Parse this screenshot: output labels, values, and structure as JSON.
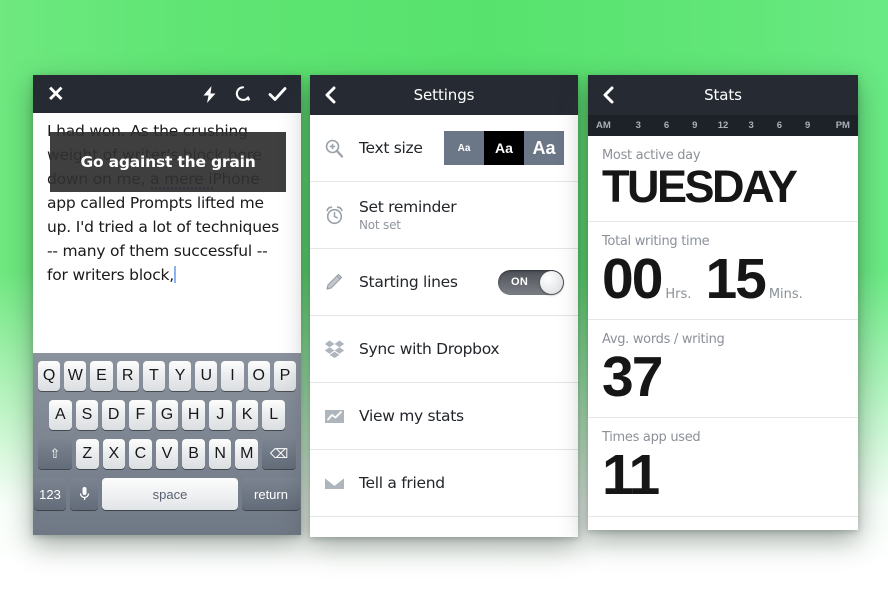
{
  "background": {
    "accent": "#5FE573"
  },
  "editor": {
    "toolbar": {
      "close_label": "✕",
      "icons": [
        "flash-icon",
        "refresh-icon",
        "check-icon"
      ]
    },
    "document_text": "I had won. As the crushing weight of writer's block bore down on me, a mere iPhone app called Prompts lifted me up. I'd tried a lot of techniques -- many of them successful -- for writers block,",
    "prompt_overlay": "Go against the grain",
    "keyboard": {
      "row1": [
        "Q",
        "W",
        "E",
        "R",
        "T",
        "Y",
        "U",
        "I",
        "O",
        "P"
      ],
      "row2": [
        "A",
        "S",
        "D",
        "F",
        "G",
        "H",
        "J",
        "K",
        "L"
      ],
      "row3": [
        "Z",
        "X",
        "C",
        "V",
        "B",
        "N",
        "M"
      ],
      "shift_label": "⇧",
      "backspace_label": "⌫",
      "num_label": "123",
      "mic_label": "mic-icon",
      "space_label": "space",
      "return_label": "return"
    }
  },
  "settings": {
    "title": "Settings",
    "back_label": "back-icon",
    "rows": [
      {
        "label": "Text size",
        "icon": "magnifier-plus-icon",
        "control": "segmented",
        "options": [
          "Aa",
          "Aa",
          "Aa"
        ],
        "selected_index": 1
      },
      {
        "label": "Set reminder",
        "sublabel": "Not set",
        "icon": "alarm-clock-icon",
        "control": "none"
      },
      {
        "label": "Starting lines",
        "icon": "pencil-icon",
        "control": "toggle",
        "toggle_state": "ON"
      },
      {
        "label": "Sync with Dropbox",
        "icon": "dropbox-icon",
        "control": "none"
      },
      {
        "label": "View my stats",
        "icon": "chart-icon",
        "control": "none"
      },
      {
        "label": "Tell a friend",
        "icon": "envelope-icon",
        "control": "none"
      }
    ]
  },
  "stats": {
    "title": "Stats",
    "back_label": "back-icon",
    "timeline_ticks": [
      "AM",
      "3",
      "6",
      "9",
      "12",
      "3",
      "6",
      "9",
      "PM"
    ],
    "blocks": [
      {
        "label": "Most active day",
        "value": "TUESDAY"
      },
      {
        "label": "Total writing time",
        "hours": "00",
        "hours_unit": "Hrs.",
        "minutes": "15",
        "minutes_unit": "Mins."
      },
      {
        "label": "Avg. words / writing",
        "value": "37"
      },
      {
        "label": "Times app used",
        "value": "11"
      }
    ]
  }
}
